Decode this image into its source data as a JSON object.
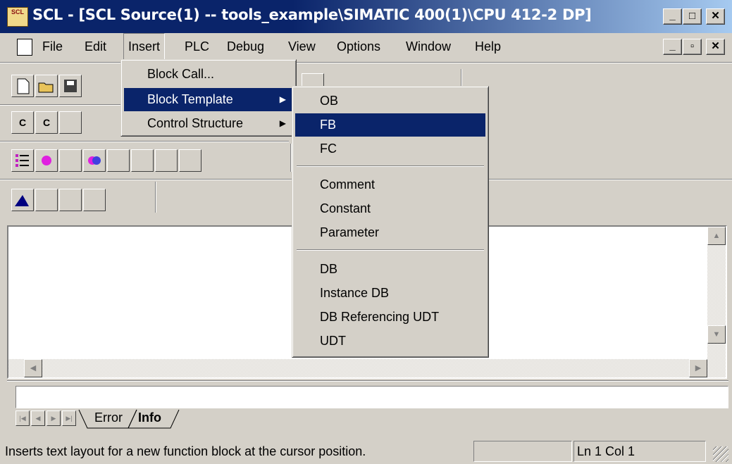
{
  "window": {
    "title": "SCL  - [SCL Source(1) -- tools_example\\SIMATIC 400(1)\\CPU 412-2 DP]",
    "app_icon_text": "SCL"
  },
  "menubar": {
    "items": [
      "File",
      "Edit",
      "Insert",
      "PLC",
      "Debug",
      "View",
      "Options",
      "Window",
      "Help"
    ]
  },
  "insert_menu": {
    "items": [
      {
        "label": "Block Call...",
        "submenu": false
      },
      {
        "label": "Block Template",
        "submenu": true,
        "selected": true
      },
      {
        "label": "Control Structure",
        "submenu": true
      }
    ]
  },
  "block_template_submenu": {
    "groups": [
      [
        "OB",
        "FB",
        "FC"
      ],
      [
        "Comment",
        "Constant",
        "Parameter"
      ],
      [
        "DB",
        "Instance DB",
        "DB Referencing UDT",
        "UDT"
      ]
    ],
    "selected": "FB"
  },
  "output_tabs": [
    "Error",
    "Info"
  ],
  "active_tab": "Info",
  "statusbar": {
    "message": "Inserts text layout for a new function block at the cursor position.",
    "position": "Ln 1 Col 1"
  },
  "colors": {
    "selection": "#0a246a",
    "face": "#d4d0c8"
  }
}
